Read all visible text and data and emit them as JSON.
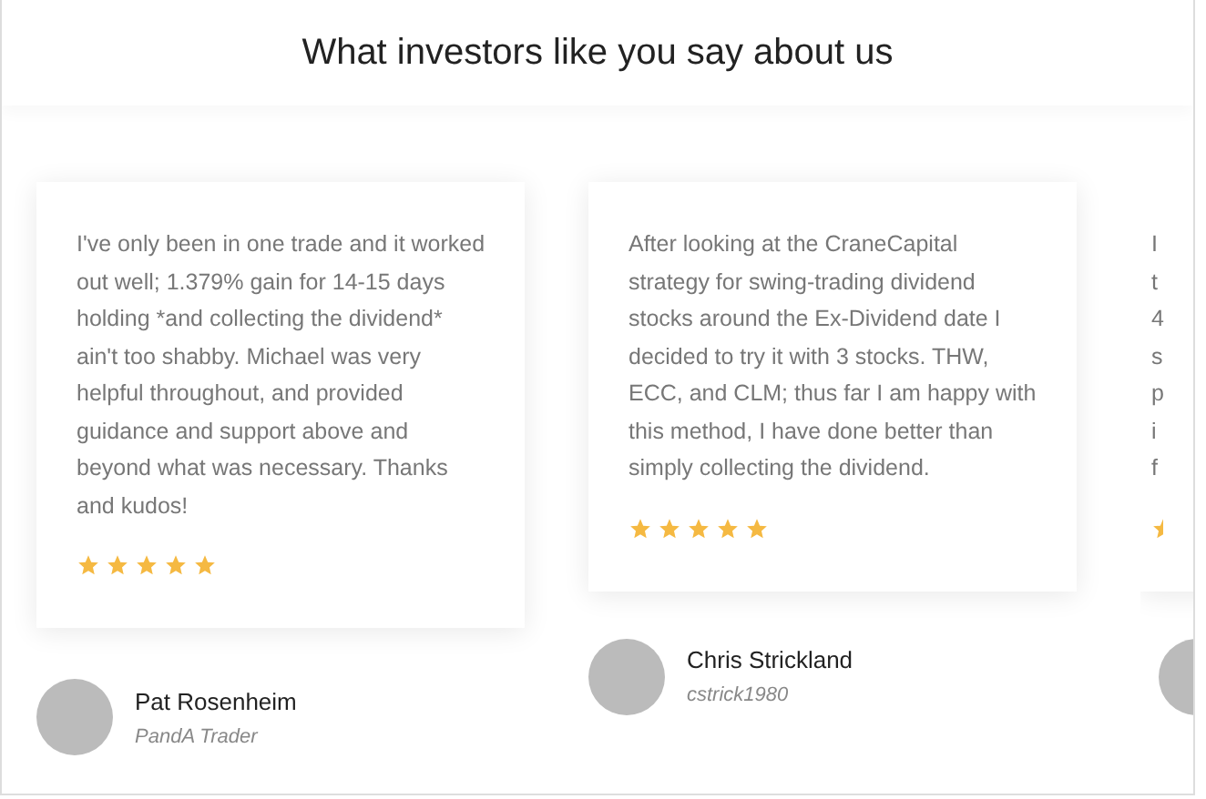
{
  "heading": "What investors like you say about us",
  "testimonials": [
    {
      "kind": "full",
      "quote": "I've only been in one trade and it worked out well; 1.379% gain for 14-15 days holding *and collecting the dividend* ain't too shabby. Michael was very helpful throughout, and provided guidance and support above and beyond what was necessary. Thanks and kudos!",
      "stars": 5,
      "name": "Pat Rosenheim",
      "subtitle": "PandA Trader"
    },
    {
      "kind": "full",
      "quote": "After looking at the CraneCapital strategy for swing-trading dividend stocks around the Ex-Dividend date I decided to try it with 3 stocks. THW, ECC, and CLM; thus far I am happy with this method, I have done better than simply collecting the dividend.",
      "stars": 5,
      "name": "Chris Strickland",
      "subtitle": "cstrick1980"
    },
    {
      "kind": "cut",
      "lines": [
        "I",
        "t",
        "4",
        "s",
        "p",
        "i",
        "f"
      ]
    }
  ]
}
